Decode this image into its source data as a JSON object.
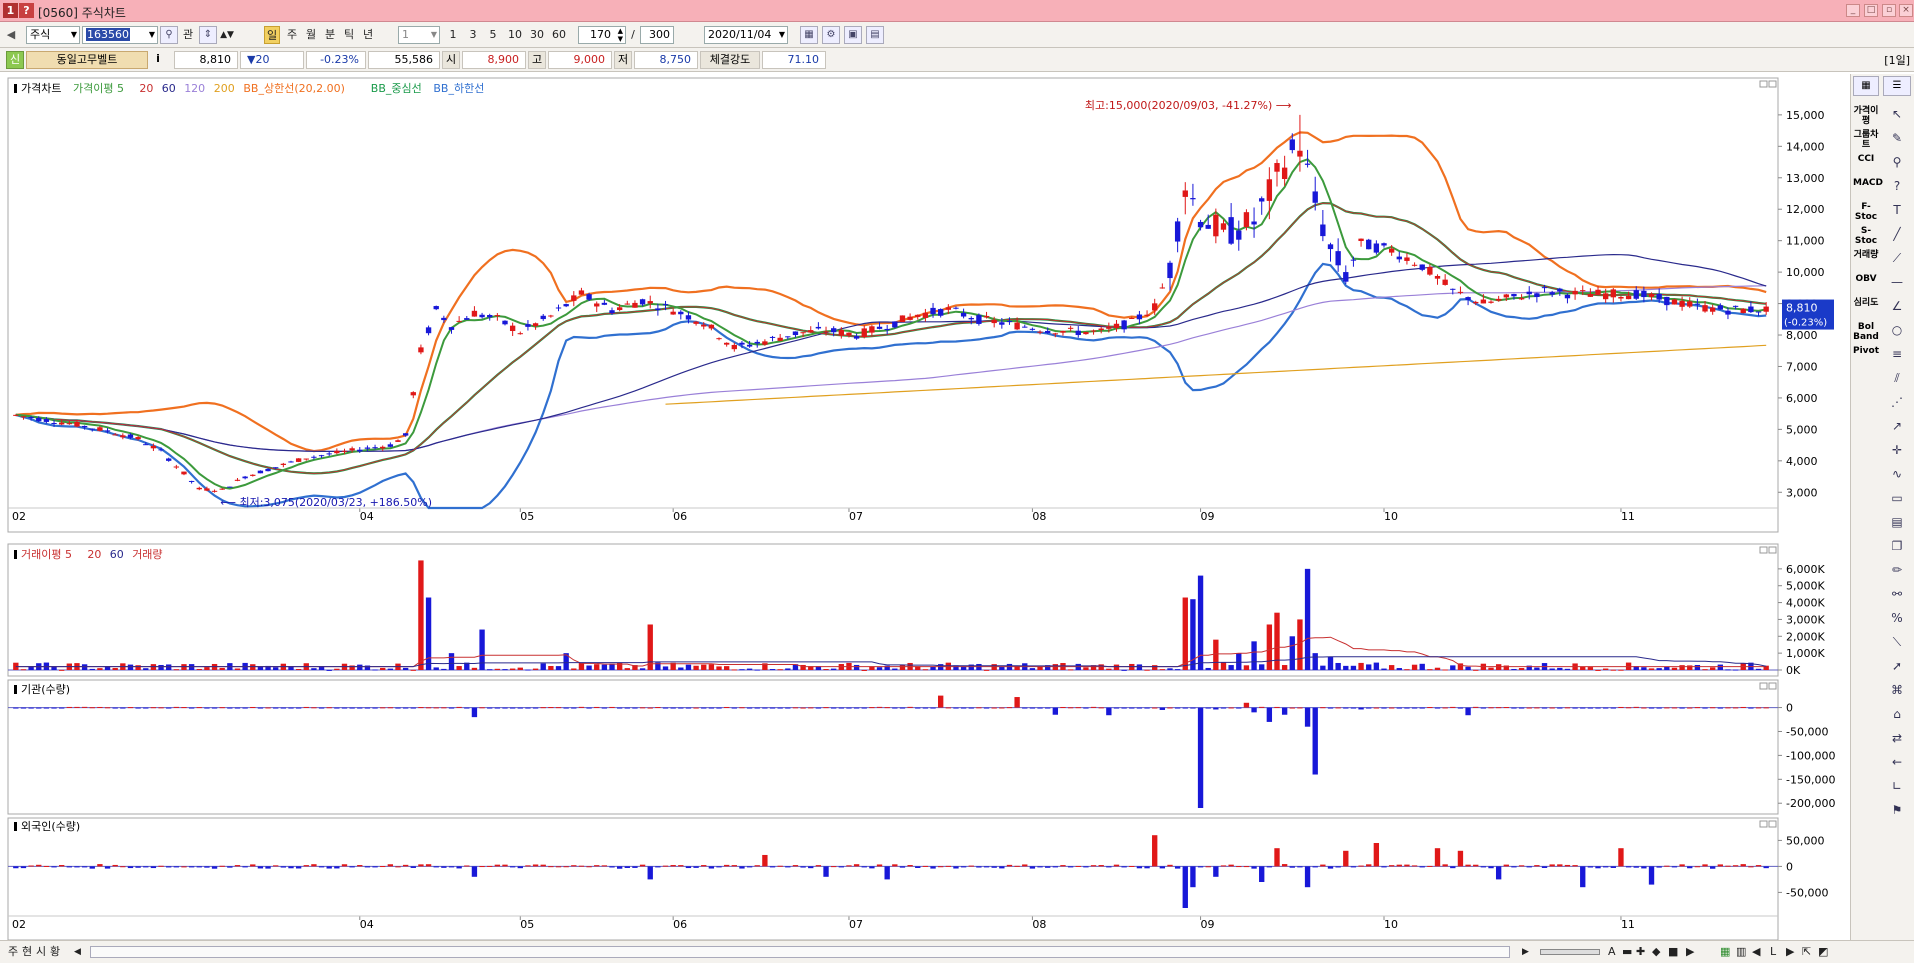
{
  "window": {
    "code": "[0560]",
    "title": "주식차트",
    "icon_labels": [
      "1",
      "?"
    ]
  },
  "toolbar": {
    "market": "주식",
    "code": "163560",
    "btn_gwan": "관",
    "periods": [
      "일",
      "주",
      "월",
      "분",
      "틱",
      "년"
    ],
    "unit_value": "1",
    "minute_presets": [
      "1",
      "3",
      "5",
      "10",
      "30",
      "60"
    ],
    "count_display": "170",
    "count_total": "300",
    "slash": "/",
    "date": "2020/11/04"
  },
  "info": {
    "badge": "신",
    "name": "동일고무벨트",
    "info_btn": "i",
    "price": "8,810",
    "change": "▼20",
    "change_rate": "-0.23%",
    "volume": "55,586",
    "open_label": "시",
    "open": "8,900",
    "high_label": "고",
    "high": "9,000",
    "low_label": "저",
    "low": "8,750",
    "strength_label": "체결강도",
    "strength": "71.10",
    "period_tag": "[1일]"
  },
  "price_panel": {
    "legend": [
      {
        "text": "가격차트",
        "color": "#000000"
      },
      {
        "text": "가격이평 5",
        "color": "#3c9a3c"
      },
      {
        "text": "20",
        "color": "#c83030"
      },
      {
        "text": "60",
        "color": "#2a2a8c"
      },
      {
        "text": "120",
        "color": "#9a80d8"
      },
      {
        "text": "200",
        "color": "#e0a020"
      },
      {
        "text": "BB_상한선(20,2.00)",
        "color": "#f07020"
      },
      {
        "text": "BB_중심선",
        "color": "#1a9a4a"
      },
      {
        "text": "BB_하한선",
        "color": "#3070d0"
      }
    ],
    "yticks": [
      "15,000",
      "14,000",
      "13,000",
      "12,000",
      "11,000",
      "10,000",
      "9,000",
      "8,000",
      "7,000",
      "6,000",
      "5,000",
      "4,000",
      "3,000"
    ],
    "ylim": [
      2500,
      15600
    ],
    "annotation_high": "최고:15,000(2020/09/03, -41.27%)",
    "annotation_low": "최저:3,075(2020/03/23, +186.50%)",
    "price_tag_price": "8,810",
    "price_tag_change": "(-0.23%)"
  },
  "volume_panel": {
    "legend": [
      {
        "text": "거래이평 5",
        "color": "#c83030"
      },
      {
        "text": "20",
        "color": "#c83030"
      },
      {
        "text": "60",
        "color": "#2a2a8c"
      },
      {
        "text": "거래량",
        "color": "#c83030"
      }
    ],
    "yticks": [
      "6,000K",
      "5,000K",
      "4,000K",
      "3,000K",
      "2,000K",
      "1,000K",
      "0K"
    ]
  },
  "inst_panel": {
    "legend": [
      {
        "text": "기관(수량)",
        "color": "#000000"
      }
    ],
    "yticks": [
      "0",
      "-50,000",
      "-100,000",
      "-150,000",
      "-200,000"
    ]
  },
  "foreign_panel": {
    "legend": [
      {
        "text": "외국인(수량)",
        "color": "#000000"
      }
    ],
    "yticks": [
      "50,000",
      "0",
      "-50,000"
    ]
  },
  "xaxis_labels": [
    "02",
    "04",
    "05",
    "06",
    "07",
    "08",
    "09",
    "10",
    "11"
  ],
  "rightbar": {
    "indicators": [
      "가격이평",
      "그룹차트",
      "CCI",
      "MACD",
      "F-Stoc",
      "S-Stoc",
      "거래량",
      "OBV",
      "심리도",
      "Bol Band",
      "Pivot"
    ]
  },
  "bottombar": {
    "tabs": [
      "주",
      "현",
      "시",
      "황"
    ]
  },
  "chart_data": [
    {
      "type": "candlestick",
      "title": "가격차트",
      "x": [
        "02",
        "04",
        "05",
        "06",
        "07",
        "08",
        "09",
        "10",
        "11"
      ],
      "ylim": [
        2500,
        15600
      ],
      "price_path": [
        [
          0,
          5450
        ],
        [
          4,
          5300
        ],
        [
          8,
          5150
        ],
        [
          12,
          4950
        ],
        [
          16,
          4700
        ],
        [
          19,
          4300
        ],
        [
          22,
          3600
        ],
        [
          24,
          3100
        ],
        [
          27,
          3075
        ],
        [
          30,
          3500
        ],
        [
          34,
          3800
        ],
        [
          38,
          4100
        ],
        [
          42,
          4250
        ],
        [
          46,
          4400
        ],
        [
          49,
          4500
        ],
        [
          51,
          4800
        ],
        [
          53,
          7500
        ],
        [
          55,
          8800
        ],
        [
          57,
          8300
        ],
        [
          60,
          8700
        ],
        [
          63,
          8500
        ],
        [
          66,
          8100
        ],
        [
          70,
          8600
        ],
        [
          74,
          9300
        ],
        [
          78,
          8800
        ],
        [
          82,
          9100
        ],
        [
          86,
          8800
        ],
        [
          90,
          8400
        ],
        [
          94,
          7600
        ],
        [
          98,
          7800
        ],
        [
          102,
          8050
        ],
        [
          106,
          8150
        ],
        [
          110,
          8000
        ],
        [
          114,
          8300
        ],
        [
          118,
          8650
        ],
        [
          122,
          8800
        ],
        [
          126,
          8500
        ],
        [
          130,
          8350
        ],
        [
          134,
          8200
        ],
        [
          138,
          8100
        ],
        [
          142,
          8100
        ],
        [
          146,
          8400
        ],
        [
          149,
          8900
        ],
        [
          151,
          10100
        ],
        [
          153,
          12800
        ],
        [
          155,
          11800
        ],
        [
          158,
          11200
        ],
        [
          162,
          11600
        ],
        [
          164,
          12500
        ],
        [
          166,
          13500
        ],
        [
          168,
          14100
        ],
        [
          170,
          12200
        ],
        [
          172,
          10700
        ],
        [
          174,
          9900
        ],
        [
          176,
          10900
        ],
        [
          180,
          10700
        ],
        [
          184,
          10200
        ],
        [
          188,
          9400
        ],
        [
          192,
          9000
        ],
        [
          196,
          9200
        ],
        [
          200,
          9400
        ],
        [
          204,
          9300
        ],
        [
          208,
          9300
        ],
        [
          212,
          9300
        ],
        [
          216,
          9100
        ],
        [
          220,
          8900
        ],
        [
          224,
          8800
        ],
        [
          228,
          8810
        ]
      ],
      "ma5_color": "#3c9a3c",
      "high": 15000,
      "low": 3075
    },
    {
      "type": "bar",
      "title": "거래량",
      "ylim": [
        0,
        7000000
      ],
      "spikes": [
        [
          53,
          6500000
        ],
        [
          54,
          4300000
        ],
        [
          57,
          1000000
        ],
        [
          61,
          2400000
        ],
        [
          72,
          1000000
        ],
        [
          83,
          2700000
        ],
        [
          153,
          4300000
        ],
        [
          154,
          4200000
        ],
        [
          155,
          5600000
        ],
        [
          157,
          1800000
        ],
        [
          160,
          1000000
        ],
        [
          162,
          1700000
        ],
        [
          164,
          2700000
        ],
        [
          165,
          3400000
        ],
        [
          167,
          2000000
        ],
        [
          168,
          3000000
        ],
        [
          169,
          6000000
        ],
        [
          170,
          1000000
        ],
        [
          172,
          800000
        ]
      ]
    },
    {
      "type": "bar",
      "title": "기관(수량)",
      "ylim": [
        -210000,
        20000
      ],
      "spikes": [
        [
          60,
          -20000
        ],
        [
          121,
          25000
        ],
        [
          131,
          22000
        ],
        [
          136,
          -15000
        ],
        [
          143,
          -16000
        ],
        [
          150,
          -5000
        ],
        [
          155,
          -210000
        ],
        [
          157,
          -4000
        ],
        [
          161,
          10000
        ],
        [
          162,
          -10000
        ],
        [
          164,
          -30000
        ],
        [
          166,
          -15000
        ],
        [
          169,
          -40000
        ],
        [
          170,
          -140000
        ],
        [
          176,
          -4000
        ],
        [
          190,
          -16000
        ]
      ]
    },
    {
      "type": "bar",
      "title": "외국인(수량)",
      "ylim": [
        -80000,
        70000
      ],
      "spikes": [
        [
          60,
          -20000
        ],
        [
          83,
          -25000
        ],
        [
          98,
          22000
        ],
        [
          106,
          -20000
        ],
        [
          114,
          -25000
        ],
        [
          149,
          60000
        ],
        [
          153,
          -80000
        ],
        [
          154,
          -40000
        ],
        [
          157,
          -20000
        ],
        [
          163,
          -30000
        ],
        [
          165,
          35000
        ],
        [
          169,
          -40000
        ],
        [
          174,
          30000
        ],
        [
          178,
          45000
        ],
        [
          186,
          35000
        ],
        [
          189,
          30000
        ],
        [
          194,
          -25000
        ],
        [
          205,
          -40000
        ],
        [
          210,
          35000
        ],
        [
          214,
          -35000
        ]
      ]
    }
  ]
}
